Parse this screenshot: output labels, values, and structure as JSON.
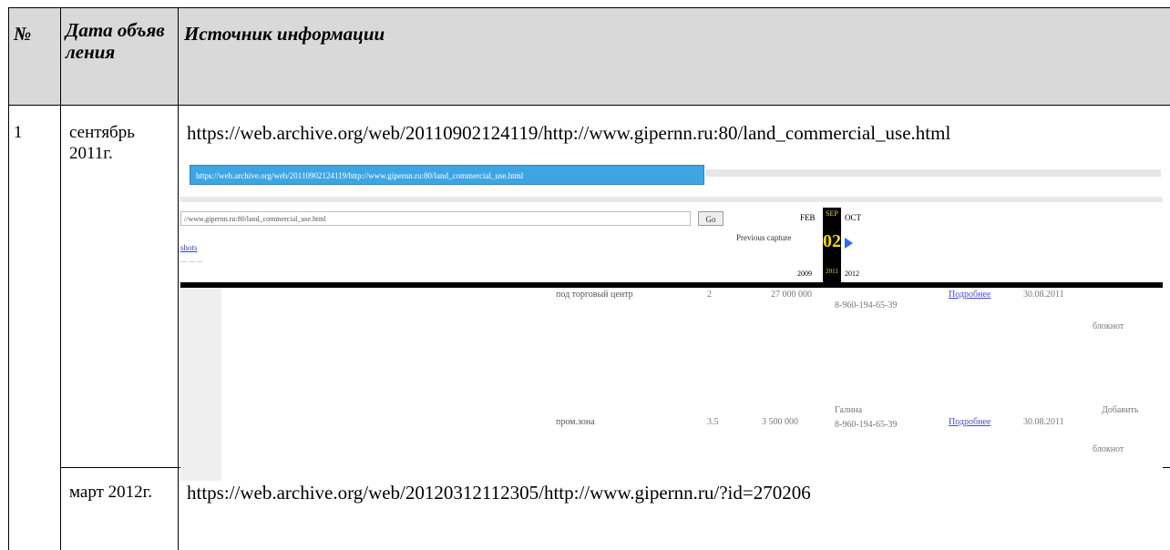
{
  "table": {
    "headers": {
      "num": "№",
      "date": "Дата объявления",
      "source": "Источник информации"
    },
    "rows": [
      {
        "num": "1",
        "date": "сентябрь 2011г.",
        "url": "https://web.archive.org/web/20110902124119/http://www.gipernn.ru:80/land_commercial_use.html"
      },
      {
        "num": "",
        "date": "март 2012г.",
        "url": "https://web.archive.org/web/20120312112305/http://www.gipernn.ru/?id=270206"
      }
    ]
  },
  "screenshot": {
    "address_bar": "https://web.archive.org/web/20110902124119/http://www.gipernn.ru:80/land_commercial_use.html",
    "wb_input": "//www.gipernn.ru:80/land_commercial_use.html",
    "go": "Go",
    "wb_link": "shots",
    "months": {
      "prev": "FEB",
      "cur": "SEP",
      "next": "OCT"
    },
    "day": "02",
    "years": {
      "prev": "2009",
      "cur": "2011",
      "next": "2012"
    },
    "prev_capture": "Previous capture",
    "listing1": {
      "type": "под торговый центр",
      "area": "2",
      "price": "27 000 000",
      "phone": "8-960-194-65-39",
      "link": "Подробнее",
      "date": "30.08.2011",
      "bloknot": "блокнот"
    },
    "listing2": {
      "type": "пром.зона",
      "area": "3.5",
      "price": "3 500 000",
      "name": "Галина",
      "phone": "8-960-194-65-39",
      "link": "Подробнее",
      "date": "30.08.2011",
      "add": "Добавить",
      "bloknot": "блокнот"
    }
  },
  "colors": {
    "header_bg": "#d9d9d9",
    "address_bar": "#3ea5e4",
    "wayback_day": "#f5d90a"
  }
}
